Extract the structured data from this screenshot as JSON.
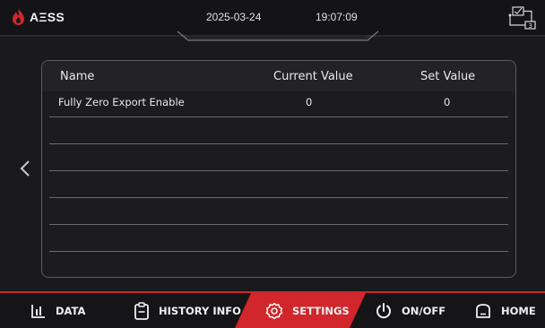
{
  "header": {
    "brand": "AΞSS",
    "date": "2025-03-24",
    "time": "19:07:09"
  },
  "colors": {
    "accent": "#d0262c",
    "background": "#1a1a1c",
    "panel_border": "#5a5a60"
  },
  "table": {
    "columns": [
      "Name",
      "Current Value",
      "Set Value"
    ],
    "rows": [
      {
        "name": "Fully Zero Export Enable",
        "current": "0",
        "set": "0"
      }
    ]
  },
  "nav": {
    "prev_icon": "chevron-left-icon",
    "items": [
      {
        "label": "DATA",
        "icon": "bar-chart-icon"
      },
      {
        "label": "HISTORY INFO",
        "icon": "clipboard-icon"
      },
      {
        "label": "SETTINGS",
        "icon": "gear-icon",
        "active": true
      },
      {
        "label": "ON/OFF",
        "icon": "power-icon"
      },
      {
        "label": "HOME",
        "icon": "home-icon"
      }
    ]
  }
}
